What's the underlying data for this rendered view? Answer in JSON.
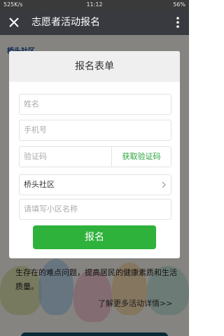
{
  "status_bar": {
    "network": "525K/s",
    "time": "11:12",
    "battery": "56%"
  },
  "title_bar": {
    "title": "志愿者活动报名"
  },
  "background": {
    "logo_text": "桥头社区…",
    "paragraph": "生存在的难点问题，提高居民的健康素质和生活质量。",
    "more_link": "了解更多活动详情>>"
  },
  "form": {
    "heading": "报名表单",
    "name_placeholder": "姓名",
    "phone_placeholder": "手机号",
    "code_placeholder": "验证码",
    "get_code_label": "获取验证码",
    "community_value": "桥头社区",
    "estate_placeholder": "请填写小区名称",
    "submit_label": "报名"
  },
  "colors": {
    "accent_green": "#2fb23c",
    "titlebar": "#393a3f"
  }
}
